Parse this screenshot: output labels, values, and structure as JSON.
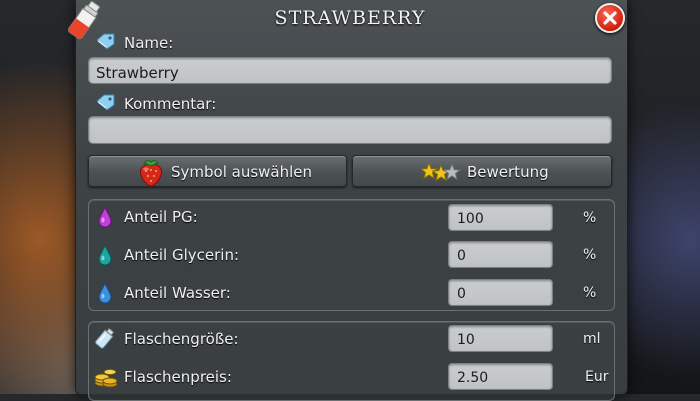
{
  "dialog": {
    "title": "STRAWBERRY",
    "name_label": "Name:",
    "name_value": "Strawberry",
    "comment_label": "Kommentar:",
    "comment_value": "",
    "symbol_button_label": "Symbol auswählen",
    "rating_button_label": "Bewertung"
  },
  "ratios": [
    {
      "label": "Anteil PG:",
      "value": "100",
      "unit": "%",
      "icon": "purple-drop-icon",
      "color": "#c040d8"
    },
    {
      "label": "Anteil Glycerin:",
      "value": "0",
      "unit": "%",
      "icon": "teal-drop-icon",
      "color": "#1aa5a0"
    },
    {
      "label": "Anteil Wasser:",
      "value": "0",
      "unit": "%",
      "icon": "blue-drop-icon",
      "color": "#3a8fe0"
    }
  ],
  "bottle": [
    {
      "label": "Flaschengröße:",
      "value": "10",
      "unit": "ml",
      "icon": "bottle-icon"
    },
    {
      "label": "Flaschenpreis:",
      "value": "2.50",
      "unit": "Eur",
      "icon": "coins-icon"
    }
  ],
  "colors": {
    "close": "#d11d0c",
    "input_bg": "#c4c8ca",
    "dialog_bg": "#43484b"
  }
}
